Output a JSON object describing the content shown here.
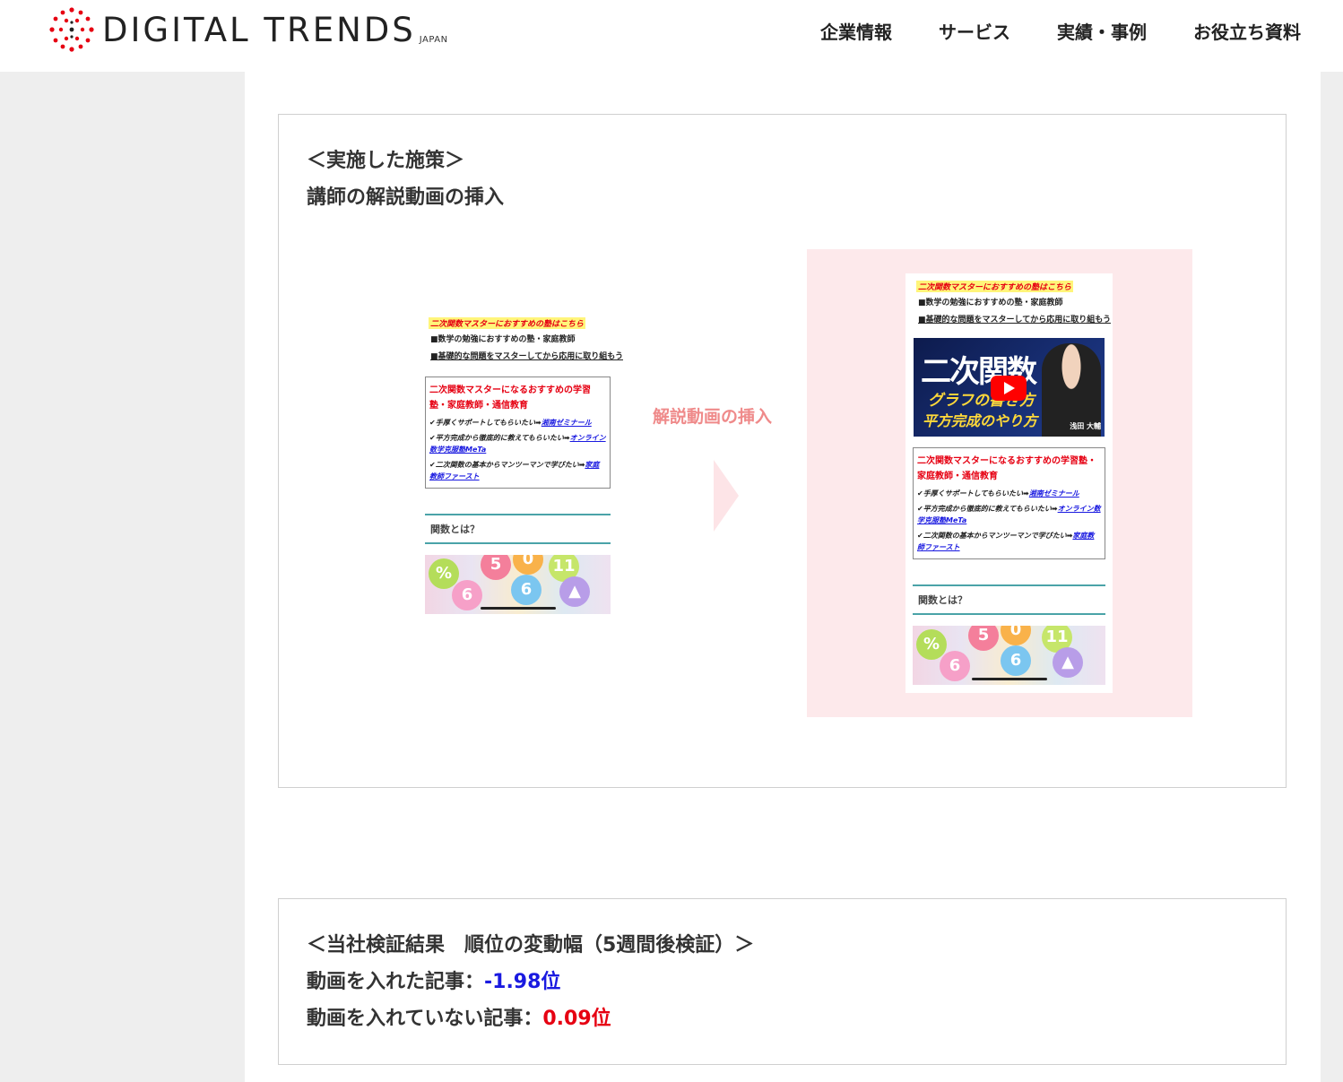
{
  "header": {
    "logo_text": "DIGITAL TRENDS",
    "logo_sub": "JAPAN",
    "nav": [
      "企業情報",
      "サービス",
      "実績・事例",
      "お役立ち資料"
    ]
  },
  "measure": {
    "heading1": "＜実施した施策＞",
    "heading2": "講師の解説動画の挿入",
    "arrow_label": "解説動画の挿入"
  },
  "screenshot": {
    "highlight": "二次関数マスターにおすすめの塾はこちら",
    "lines": [
      "■数学の勉強におすすめの塾・家庭教師",
      "■基礎的な問題をマスターしてから応用に取り組もう"
    ],
    "box_title": "二次関数マスターになるおすすめの学習塾・家庭教師・通信教育",
    "items": [
      {
        "text": "✔手厚くサポートしてもらいたい➡",
        "link": "湘南ゼミナール"
      },
      {
        "text": "✔平方完成から徹底的に教えてもらいたい➡",
        "link": "オンライン数学克服塾MeTa"
      },
      {
        "text": "✔二次関数の基本からマンツーマンで学びたい➡",
        "link": "家庭教師ファースト"
      }
    ],
    "section_title": "関数とは？",
    "video_title": "二次関数",
    "video_sub1": "グラフの書き方",
    "video_sub2": "平方完成のやり方",
    "video_name": "浅田 大輔"
  },
  "result": {
    "heading": "＜当社検証結果　順位の変動幅（5週間後検証）＞",
    "with_label": "動画を入れた記事：",
    "with_value": "-1.98位",
    "without_label": "動画を入れていない記事：",
    "without_value": "0.09位"
  },
  "colors": {
    "accent_blue": "#1a1ae0",
    "accent_red": "#e60012",
    "pink_bg": "#fde9eb"
  }
}
